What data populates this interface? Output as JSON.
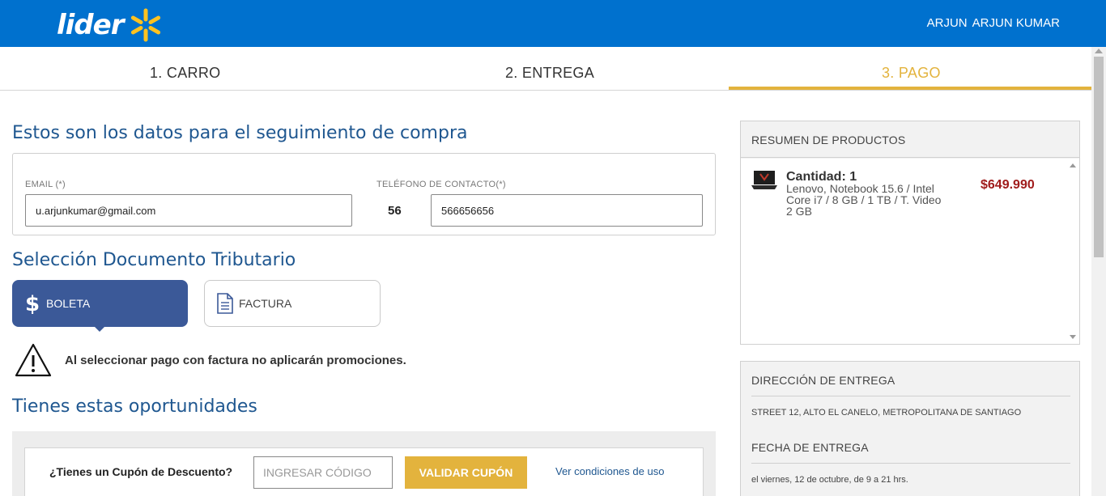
{
  "header": {
    "logo_text": "lider",
    "user_first": "ARJUN",
    "user_full": "ARJUN KUMAR",
    "brand_color": "#0071ce",
    "spark_color": "#ffc220"
  },
  "steps": [
    {
      "label": "1. CARRO"
    },
    {
      "label": "2. ENTREGA"
    },
    {
      "label": "3. PAGO"
    }
  ],
  "tracking": {
    "title": "Estos son los datos para el seguimiento de compra",
    "email_label": "EMAIL (*)",
    "email_value": "u.arjunkumar@gmail.com",
    "phone_label": "TELÉFONO DE CONTACTO(*)",
    "phone_prefix": "56",
    "phone_value": "566656656"
  },
  "tax_doc": {
    "title": "Selección Documento Tributario",
    "boleta_label": "BOLETA",
    "factura_label": "FACTURA",
    "warning": "Al seleccionar pago con factura no aplicarán promociones."
  },
  "opportunities": {
    "title": "Tienes estas oportunidades",
    "coupon_question": "¿Tienes un Cupón de Descuento?",
    "coupon_placeholder": "INGRESAR CÓDIGO",
    "coupon_button": "VALIDAR CUPÓN",
    "conditions_link": "Ver condiciones de uso"
  },
  "summary": {
    "title": "RESUMEN DE PRODUCTOS",
    "quantity": "Cantidad: 1",
    "product": "Lenovo, Notebook 15.6 / Intel Core i7 / 8 GB / 1 TB / T. Video 2 GB",
    "price": "$649.990"
  },
  "delivery": {
    "address_title": "DIRECCIÓN DE ENTREGA",
    "address": "STREET 12, ALTO EL CANELO, METROPOLITANA DE SANTIAGO",
    "date_title": "FECHA DE ENTREGA",
    "date": "el viernes, 12 de octubre, de 9 a 21 hrs."
  }
}
